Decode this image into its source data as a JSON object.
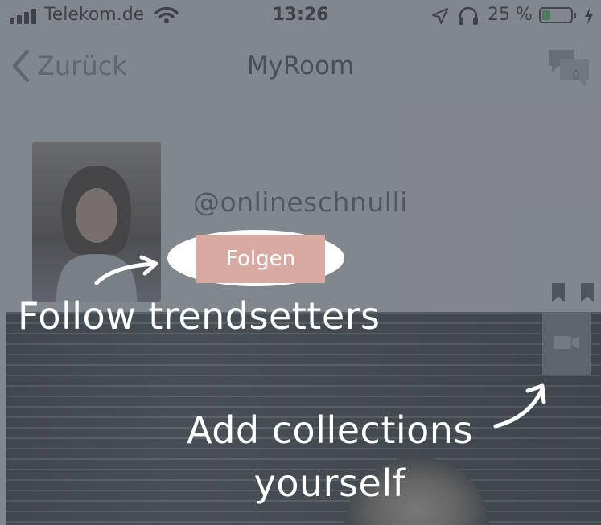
{
  "status_bar": {
    "carrier": "Telekom.de",
    "time": "13:26",
    "battery_percent": "25 %",
    "battery_level": 0.25
  },
  "navbar": {
    "back_label": "Zurück",
    "title": "MyRoom",
    "message_count": "0"
  },
  "profile": {
    "username": "@onlineschnulli",
    "follow_label": "Folgen"
  },
  "tutorial": {
    "follow_tip": "Follow trendsetters",
    "collections_tip": "Add collections yourself"
  },
  "colors": {
    "accent": "#e0a9a2",
    "overlay": "#4a525a",
    "battery": "#4fd35d"
  },
  "icons": [
    "signal-icon",
    "wifi-icon",
    "location-icon",
    "headphones-icon",
    "battery-icon",
    "charging-icon",
    "back-chevron-icon",
    "chat-icon",
    "bookmark-icon",
    "video-icon",
    "arrow-icon"
  ]
}
